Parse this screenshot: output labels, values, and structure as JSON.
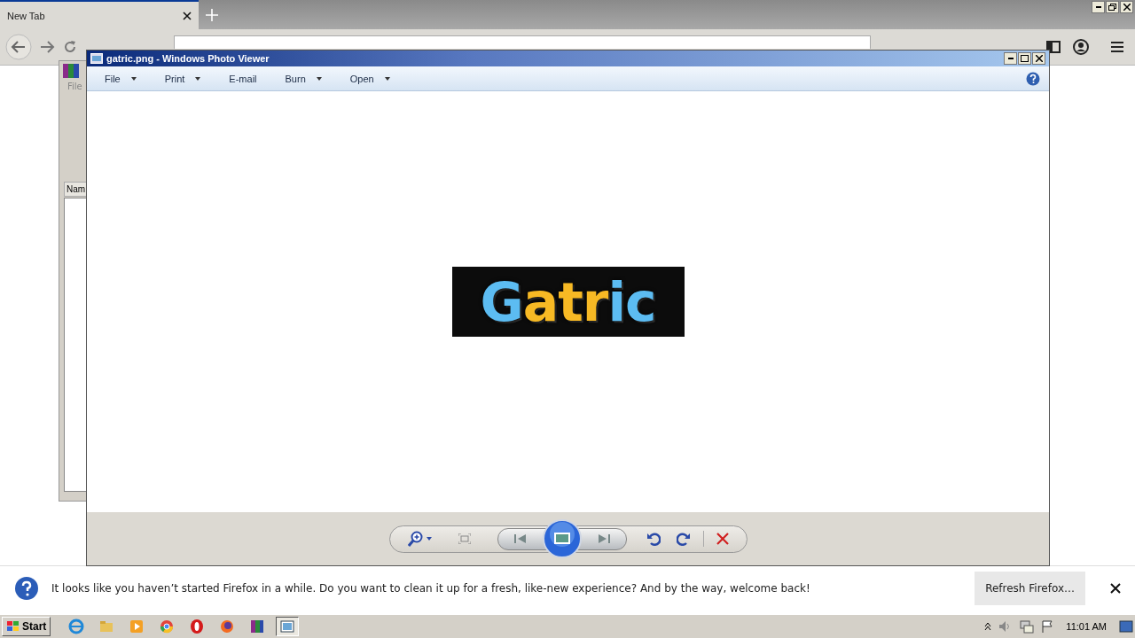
{
  "browser": {
    "tabs": [
      {
        "label": "New Tab",
        "selected": true
      }
    ]
  },
  "background_window": {
    "menu": [
      "File"
    ],
    "column_header": "Nam"
  },
  "photo_viewer": {
    "title": "gatric.png - Windows Photo Viewer",
    "menu": [
      {
        "label": "File",
        "dropdown": true
      },
      {
        "label": "Print",
        "dropdown": true
      },
      {
        "label": "E-mail",
        "dropdown": false
      },
      {
        "label": "Burn",
        "dropdown": true
      },
      {
        "label": "Open",
        "dropdown": true
      }
    ],
    "image": {
      "letters": [
        {
          "char": "G",
          "color": "#5cbcf2"
        },
        {
          "char": "a",
          "color": "#f7b924"
        },
        {
          "char": "t",
          "color": "#f7b924"
        },
        {
          "char": "r",
          "color": "#f7b924"
        },
        {
          "char": "i",
          "color": "#5cbcf2"
        },
        {
          "char": "c",
          "color": "#5cbcf2"
        }
      ]
    }
  },
  "notification": {
    "message": "It looks like you haven’t started Firefox in a while. Do you want to clean it up for a fresh, like-new experience? And by the way, welcome back!",
    "button": "Refresh Firefox…"
  },
  "taskbar": {
    "start": "Start",
    "apps": [
      {
        "kind": "ie",
        "selected": false
      },
      {
        "kind": "folder",
        "selected": false
      },
      {
        "kind": "media",
        "selected": false
      },
      {
        "kind": "chrome",
        "selected": false
      },
      {
        "kind": "opera",
        "selected": false
      },
      {
        "kind": "firefox",
        "selected": false
      },
      {
        "kind": "winrar",
        "selected": false
      },
      {
        "kind": "photo",
        "selected": true
      }
    ],
    "clock": "11:01 AM"
  }
}
